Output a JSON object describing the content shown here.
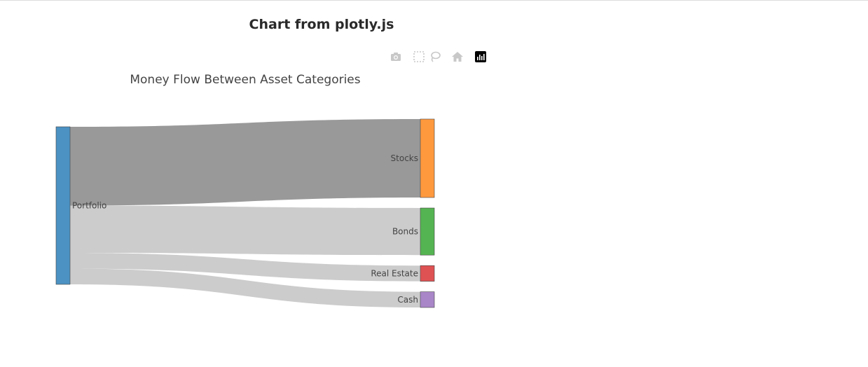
{
  "page": {
    "title": "Chart from plotly.js"
  },
  "modebar": {
    "icons": [
      "camera-icon",
      "box-select-icon",
      "lasso-icon",
      "home-icon",
      "plotly-logo-icon"
    ],
    "colors": {
      "inactive": "#c8c8c8",
      "logo": "#000000"
    }
  },
  "chart_data": {
    "type": "sankey",
    "title": "Money Flow Between Asset Categories",
    "nodes": [
      {
        "label": "Portfolio",
        "color": "#4c92c3"
      },
      {
        "label": "Stocks",
        "color": "#ff993e"
      },
      {
        "label": "Bonds",
        "color": "#55b452"
      },
      {
        "label": "Real Estate",
        "color": "#de5253"
      },
      {
        "label": "Cash",
        "color": "#a986c7"
      }
    ],
    "links": [
      {
        "source": 0,
        "target": 1,
        "value": 50,
        "color": "#999999"
      },
      {
        "source": 0,
        "target": 2,
        "value": 30,
        "color": "#cccccc"
      },
      {
        "source": 0,
        "target": 3,
        "value": 10,
        "color": "#cccccc"
      },
      {
        "source": 0,
        "target": 4,
        "value": 10,
        "color": "#cccccc"
      }
    ],
    "node_border_color": "#444444"
  }
}
